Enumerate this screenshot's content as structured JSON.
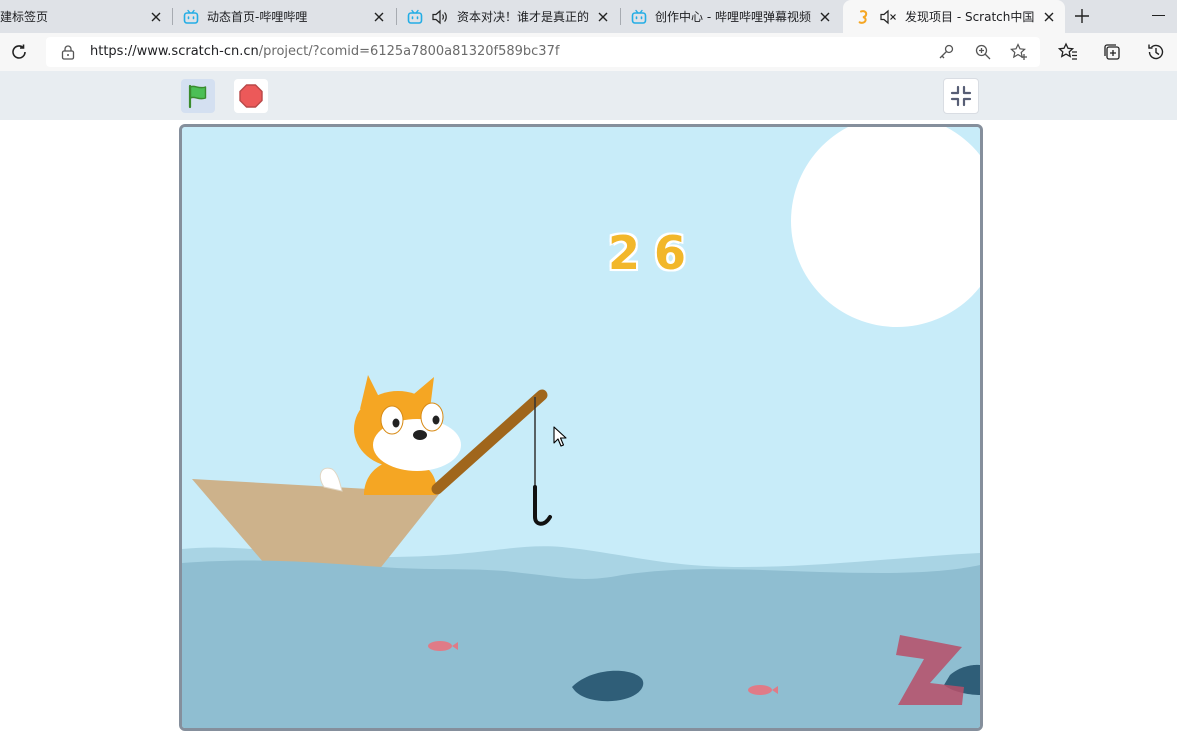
{
  "browser": {
    "tabs": [
      {
        "title": "建标签页",
        "favicon": "blank-icon",
        "active": false
      },
      {
        "title": "动态首页-哔哩哔哩",
        "favicon": "bilibili-icon",
        "active": false
      },
      {
        "title": "资本对决！谁才是真正的",
        "favicon": "bilibili-icon",
        "active": false,
        "audio": "speaker-icon"
      },
      {
        "title": "创作中心 - 哔哩哔哩弹幕视频",
        "favicon": "bilibili-icon",
        "active": false
      },
      {
        "title": "发现项目 - Scratch中国",
        "favicon": "scratch-icon",
        "active": true,
        "audio": "muted-speaker-icon"
      }
    ],
    "address": {
      "url_host": "https://www.scratch-cn.cn",
      "url_path": "/project/?comid=6125a7800a81320f589bc37f"
    },
    "toolbar_icons": [
      "key-icon",
      "zoom-icon",
      "add-favorite-icon",
      "favorites-icon",
      "collections-icon",
      "history-icon"
    ]
  },
  "player": {
    "controls": [
      "green-flag-icon",
      "stop-icon",
      "exit-fullscreen-icon"
    ]
  },
  "stage": {
    "score": "26",
    "colors": {
      "sky": "#c8ecf9",
      "water": "#8fbed1",
      "sun": "#ffffff",
      "boat": "#cdb28b",
      "cat": "#f5a623",
      "rod": "#a0661c",
      "fish_dark": "#2f5e78",
      "fish_pink": "#e07b87"
    }
  }
}
